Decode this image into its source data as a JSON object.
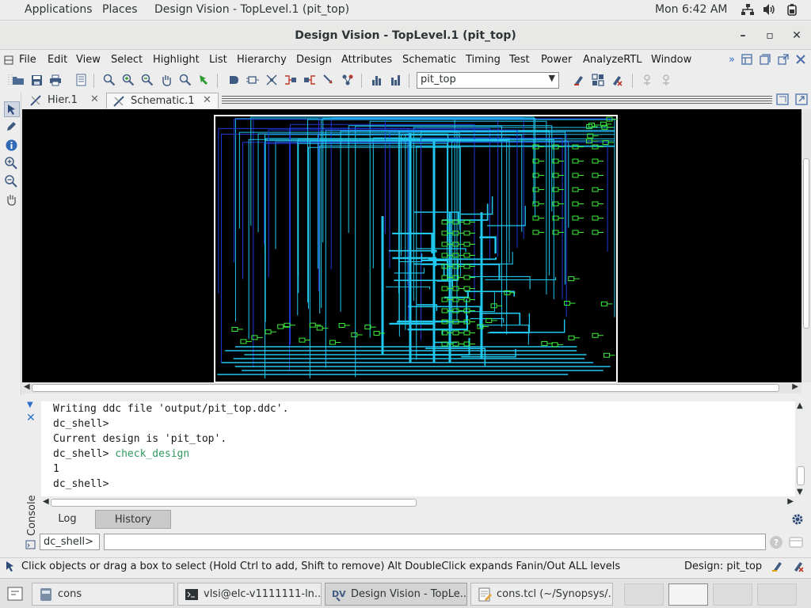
{
  "topbar": {
    "applications": "Applications",
    "places": "Places",
    "active_window": "Design Vision - TopLevel.1 (pit_top)",
    "clock": "Mon  6:42 AM"
  },
  "window": {
    "title": "Design Vision - TopLevel.1 (pit_top)",
    "minimize": "–",
    "maximize": "▫",
    "close": "✕"
  },
  "menubar": {
    "items": [
      "File",
      "Edit",
      "View",
      "Select",
      "Highlight",
      "List",
      "Hierarchy",
      "Design",
      "Attributes",
      "Schematic",
      "Timing",
      "Test",
      "Power",
      "AnalyzeRTL",
      "Window"
    ],
    "more": "»"
  },
  "toolbar": {
    "design_selected": "pit_top"
  },
  "tabs": [
    {
      "label": "Hier.1"
    },
    {
      "label": "Schematic.1"
    }
  ],
  "console": {
    "label": "Console",
    "lines": [
      {
        "text": "Writing ddc file 'output/pit_top.ddc'."
      },
      {
        "text": "dc_shell>"
      },
      {
        "text": "Current design is 'pit_top'."
      },
      {
        "prompt": "dc_shell> ",
        "command": "check_design"
      },
      {
        "text": "1"
      },
      {
        "text": "dc_shell>"
      }
    ],
    "tab_log": "Log",
    "tab_history": "History",
    "prompt": "dc_shell>",
    "command_value": ""
  },
  "status": {
    "message": "Click objects or drag a box to select (Hold Ctrl to add, Shift to remove) Alt DoubleClick expands Fanin/Out ALL levels",
    "design": "Design: pit_top"
  },
  "taskbar": {
    "tasks": [
      {
        "label": "cons"
      },
      {
        "label": "vlsi@elc-v1111111-ln..."
      },
      {
        "label": "Design Vision - TopLe..."
      },
      {
        "label": "cons.tcl (~/Synopsys/..."
      }
    ]
  },
  "colors": {
    "schematic_background": "#000000",
    "wire_cyan": "#20c8f0",
    "wire_blue": "#2038d8",
    "cell_green": "#3cf03c",
    "command_text": "#2f9a5f"
  }
}
